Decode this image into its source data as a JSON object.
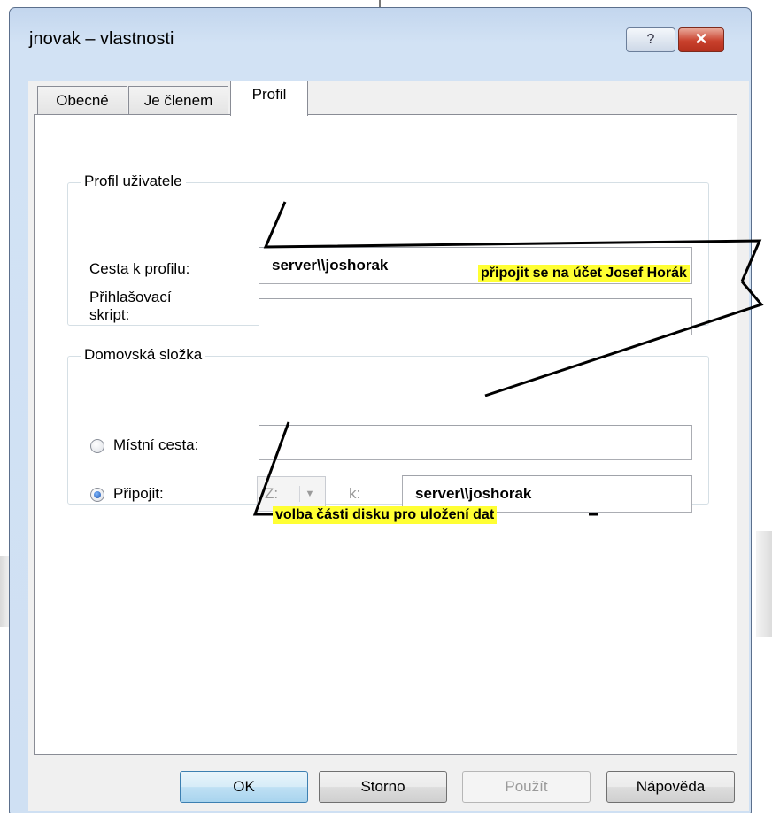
{
  "window": {
    "title": "jnovak – vlastnosti",
    "help_button": "?",
    "close_button": "✕"
  },
  "tabs": [
    {
      "label": "Obecné",
      "active": false
    },
    {
      "label": "Je členem",
      "active": false
    },
    {
      "label": "Profil",
      "active": true
    }
  ],
  "profile_group": {
    "legend": "Profil uživatele",
    "profile_path_label": "Cesta k profilu:",
    "profile_path_value": "server\\\\joshorak",
    "logon_script_label_line1": "Přihlašovací",
    "logon_script_label_line2": "skript:",
    "logon_script_value": ""
  },
  "home_group": {
    "legend": "Domovská složka",
    "local_path_label": "Místní cesta:",
    "local_path_selected": false,
    "local_path_value": "",
    "connect_label": "Připojit:",
    "connect_selected": true,
    "drive_value": "Z:",
    "to_label": "k:",
    "connect_path_value": "server\\\\joshorak"
  },
  "buttons": {
    "ok": "OK",
    "cancel": "Storno",
    "apply": "Použít",
    "help": "Nápověda"
  },
  "annotations": {
    "account_note": "připojit se na účet Josef Horák",
    "drive_note": "volba části disku pro uložení dat"
  },
  "colors": {
    "annotation_highlight": "#ffff33",
    "close_button": "#c9412d",
    "ok_button_border": "#3c7fb1"
  }
}
